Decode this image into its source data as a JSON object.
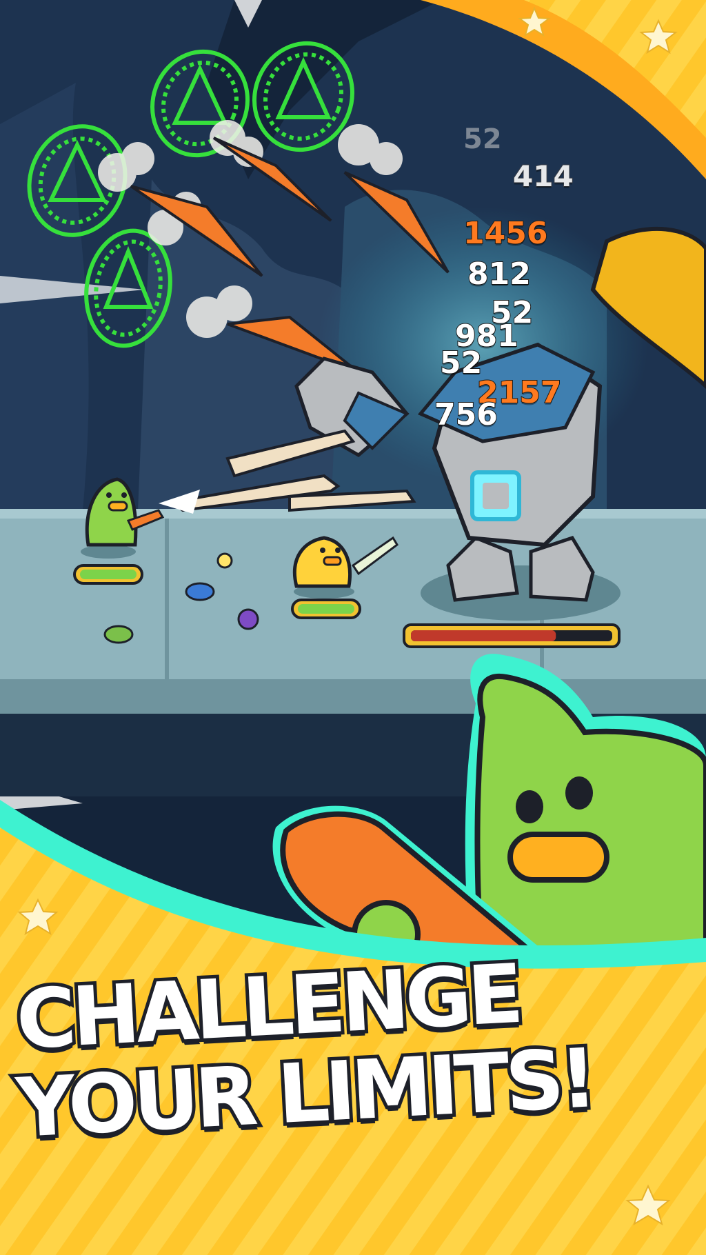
{
  "promo": {
    "headline_line1": "CHALLENGE",
    "headline_line2": "YOUR LIMITS!"
  },
  "damage_numbers": [
    {
      "value": "52",
      "style": "faint"
    },
    {
      "value": "414",
      "style": "grey"
    },
    {
      "value": "1456",
      "style": "orange"
    },
    {
      "value": "812",
      "style": "white"
    },
    {
      "value": "52",
      "style": "white"
    },
    {
      "value": "981",
      "style": "white"
    },
    {
      "value": "52",
      "style": "white"
    },
    {
      "value": "2157",
      "style": "orange"
    },
    {
      "value": "756",
      "style": "white"
    }
  ],
  "health_bars": {
    "player_duck_green": 1.0,
    "ally_duck_yellow": 1.0,
    "boss_golem": 0.72
  },
  "colors": {
    "sky_dark": "#14243a",
    "cave_mid": "#2c4564",
    "floor": "#8fb4bd",
    "banner_yellow": "#ffc72c",
    "accent_cyan": "#3ef2d0",
    "hp_green": "#7cd34a",
    "hp_red": "#c0392b",
    "carrot": "#f47c2a",
    "rune_green": "#36e03c",
    "duck_green": "#8fd44a",
    "duck_yellow": "#ffd23a"
  },
  "icons": [
    "rune-circle-icon",
    "carrot-projectile-icon",
    "star-icon",
    "banana-boomerang-icon",
    "leek-icon"
  ]
}
